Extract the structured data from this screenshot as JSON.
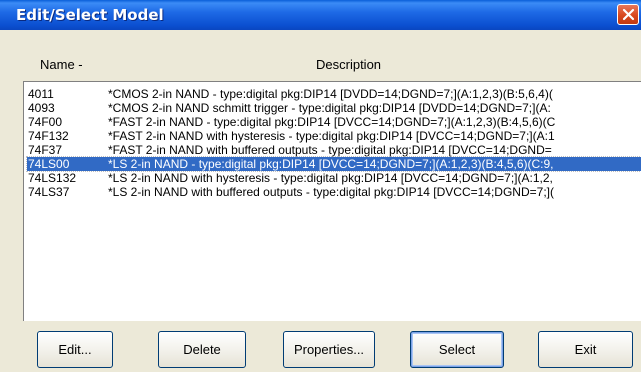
{
  "window": {
    "title": "Edit/Select Model"
  },
  "columns": {
    "name": "Name -",
    "description": "Description"
  },
  "models": [
    {
      "name": "4011",
      "description": "*CMOS 2-in NAND - type:digital pkg:DIP14 [DVDD=14;DGND=7;](A:1,2,3)(B:5,6,4)(",
      "selected": false
    },
    {
      "name": "4093",
      "description": "*CMOS 2-in NAND schmitt trigger - type:digital pkg:DIP14 [DVDD=14;DGND=7;](A:",
      "selected": false
    },
    {
      "name": "74F00",
      "description": "*FAST 2-in NAND - type:digital pkg:DIP14 [DVCC=14;DGND=7;](A:1,2,3)(B:4,5,6)(C",
      "selected": false
    },
    {
      "name": "74F132",
      "description": "*FAST 2-in NAND with hysteresis - type:digital pkg:DIP14 [DVCC=14;DGND=7;](A:1",
      "selected": false
    },
    {
      "name": "74F37",
      "description": "*FAST 2-in NAND with buffered outputs - type:digital pkg:DIP14 [DVCC=14;DGND=",
      "selected": false
    },
    {
      "name": "74LS00",
      "description": "*LS 2-in NAND - type:digital pkg:DIP14 [DVCC=14;DGND=7;](A:1,2,3)(B:4,5,6)(C:9,",
      "selected": true
    },
    {
      "name": "74LS132",
      "description": "*LS 2-in NAND with hysteresis - type:digital pkg:DIP14 [DVCC=14;DGND=7;](A:1,2,",
      "selected": false
    },
    {
      "name": "74LS37",
      "description": "*LS 2-in NAND with buffered outputs - type:digital pkg:DIP14 [DVCC=14;DGND=7;](",
      "selected": false
    }
  ],
  "buttons": {
    "edit": "Edit...",
    "delete": "Delete",
    "properties": "Properties...",
    "select": "Select",
    "exit": "Exit"
  },
  "colors": {
    "titlebar": "#0b4fd0",
    "selection": "#316ac5",
    "close": "#d8481e",
    "dialog_bg": "#ece9d8"
  }
}
